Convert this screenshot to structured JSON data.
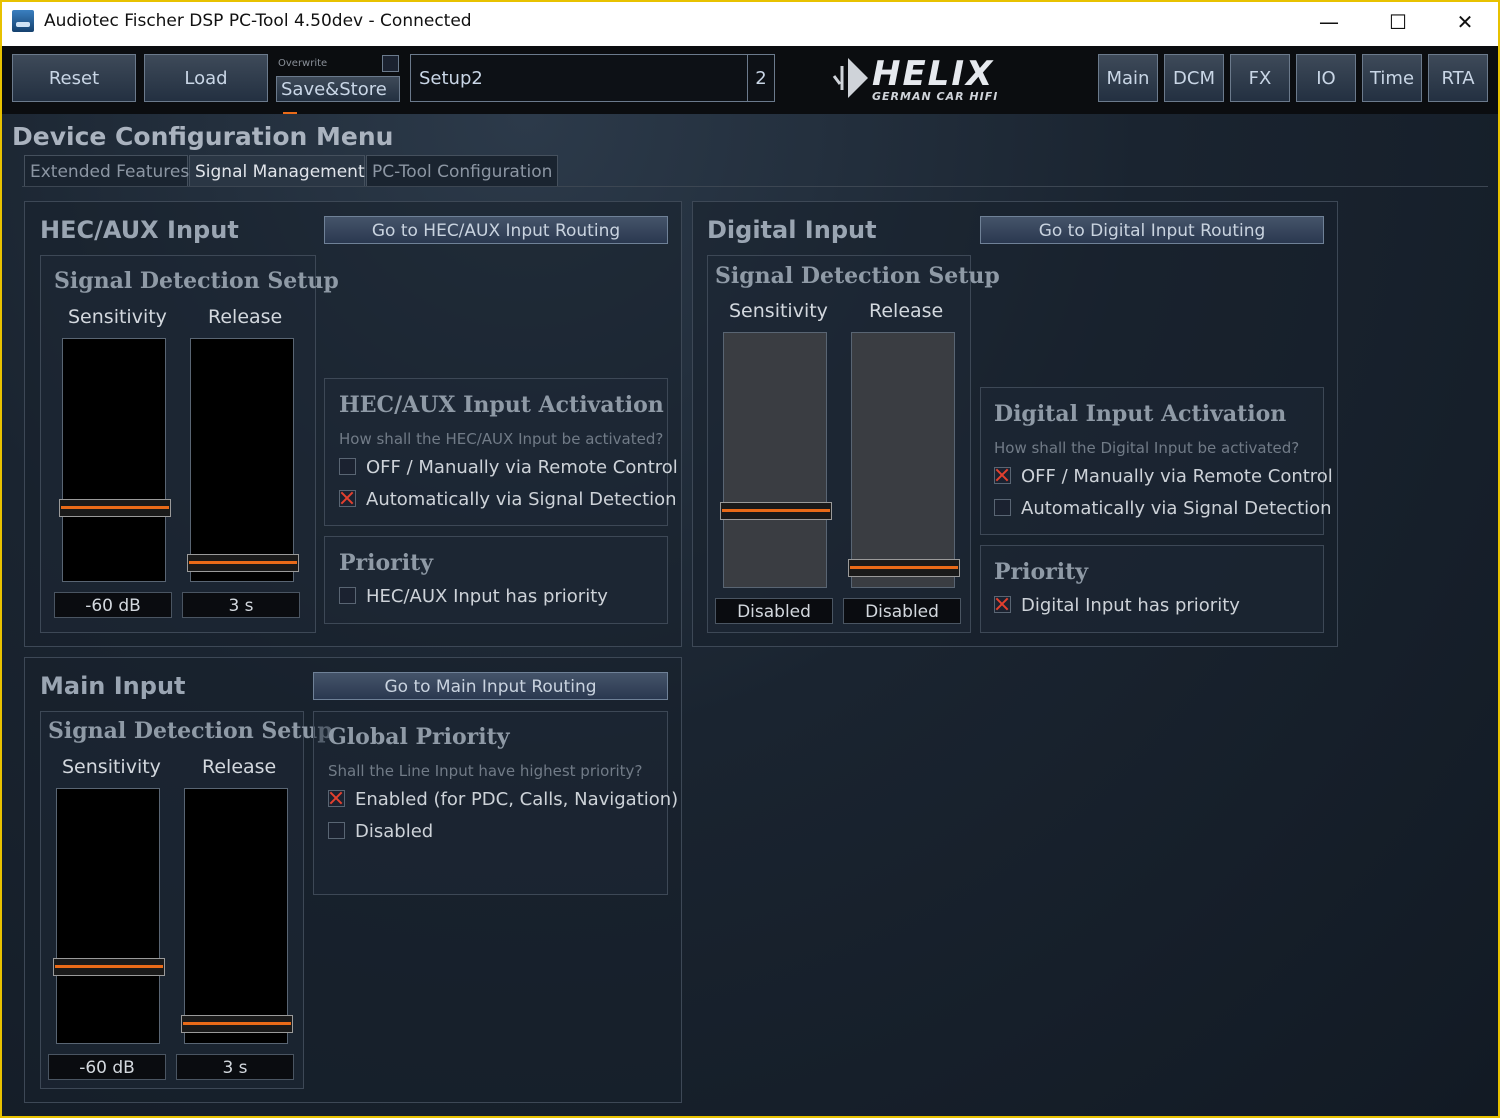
{
  "window": {
    "title": "Audiotec Fischer DSP PC-Tool 4.50dev - Connected",
    "controls": {
      "minimize": "—",
      "maximize": "☐",
      "close": "✕"
    }
  },
  "toolbar": {
    "reset_label": "Reset",
    "load_label": "Load",
    "overwrite_label": "Overwrite",
    "savestore_label": "Save&Store",
    "setup_name": "Setup2",
    "setup_number": "2",
    "logo_text": "HELIX",
    "logo_sub": "GERMAN CAR HIFI",
    "nav": [
      "Main",
      "DCM",
      "FX",
      "IO",
      "Time",
      "RTA"
    ]
  },
  "menu": {
    "title": "Device Configuration Menu",
    "tabs": [
      "Extended Features",
      "Signal Management",
      "PC-Tool Configuration"
    ],
    "active_tab": "Signal Management"
  },
  "hec": {
    "title": "HEC/AUX Input",
    "routing_button": "Go to HEC/AUX Input Routing",
    "detect_title": "Signal Detection Setup",
    "sensitivity_label": "Sensitivity",
    "release_label": "Release",
    "sensitivity_value": "-60 dB",
    "release_value": "3 s",
    "sensitivity_level": 0.29,
    "release_level": 0.05,
    "activation_title": "HEC/AUX Input Activation",
    "activation_hint": "How shall the HEC/AUX Input be activated?",
    "option_off": "OFF / Manually via Remote Control",
    "option_auto": "Automatically via Signal Detection",
    "priority_title": "Priority",
    "priority_option": "HEC/AUX Input has priority"
  },
  "digital": {
    "title": "Digital Input",
    "routing_button": "Go to Digital Input Routing",
    "detect_title": "Signal Detection Setup",
    "sensitivity_label": "Sensitivity",
    "release_label": "Release",
    "sensitivity_value": "Disabled",
    "release_value": "Disabled",
    "sensitivity_level": 0.29,
    "release_level": 0.05,
    "activation_title": "Digital Input Activation",
    "activation_hint": "How shall the Digital Input be activated?",
    "option_off": "OFF / Manually via Remote Control",
    "option_auto": "Automatically via Signal Detection",
    "priority_title": "Priority",
    "priority_option": "Digital Input has priority"
  },
  "main_input": {
    "title": "Main Input",
    "routing_button": "Go to Main Input Routing",
    "detect_title": "Signal Detection Setup",
    "sensitivity_label": "Sensitivity",
    "release_label": "Release",
    "sensitivity_value": "-60 dB",
    "release_value": "3 s",
    "sensitivity_level": 0.29,
    "release_level": 0.05,
    "global_title": "Global Priority",
    "global_hint": "Shall the Line Input have highest priority?",
    "option_enabled": "Enabled (for PDC, Calls, Navigation)",
    "option_disabled": "Disabled"
  },
  "colors": {
    "accent_orange": "#e96a18",
    "check_red": "#e3412f",
    "window_border": "#e8c200"
  }
}
